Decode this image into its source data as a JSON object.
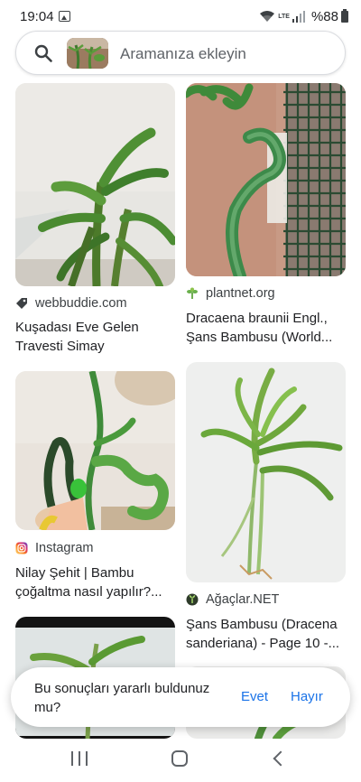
{
  "status_bar": {
    "time": "19:04",
    "network": "LTE",
    "battery": "%88"
  },
  "search": {
    "placeholder": "Aramanıza ekleyin"
  },
  "results": [
    {
      "source": "webbuddie.com",
      "source_icon": "tag-icon",
      "title": "Kuşadası Eve Gelen Travesti Simay"
    },
    {
      "source": "plantnet.org",
      "source_icon": "plantnet-logo-icon",
      "title": "Dracaena braunii Engl., Şans Bambusu (World..."
    },
    {
      "source": "Instagram",
      "source_icon": "instagram-icon",
      "title": "Nilay Şehit | Bambu çoğaltma nasıl yapılır?..."
    },
    {
      "source": "Ağaçlar.NET",
      "source_icon": "agaclar-logo-icon",
      "title": "Şans Bambusu (Dracena sanderiana) - Page 10 -..."
    }
  ],
  "feedback": {
    "question": "Bu sonuçları yararlı buldunuz mu?",
    "yes_label": "Evet",
    "no_label": "Hayır"
  },
  "colors": {
    "link_blue": "#1a73e8",
    "text_primary": "#202124",
    "text_secondary": "#3c4043"
  }
}
